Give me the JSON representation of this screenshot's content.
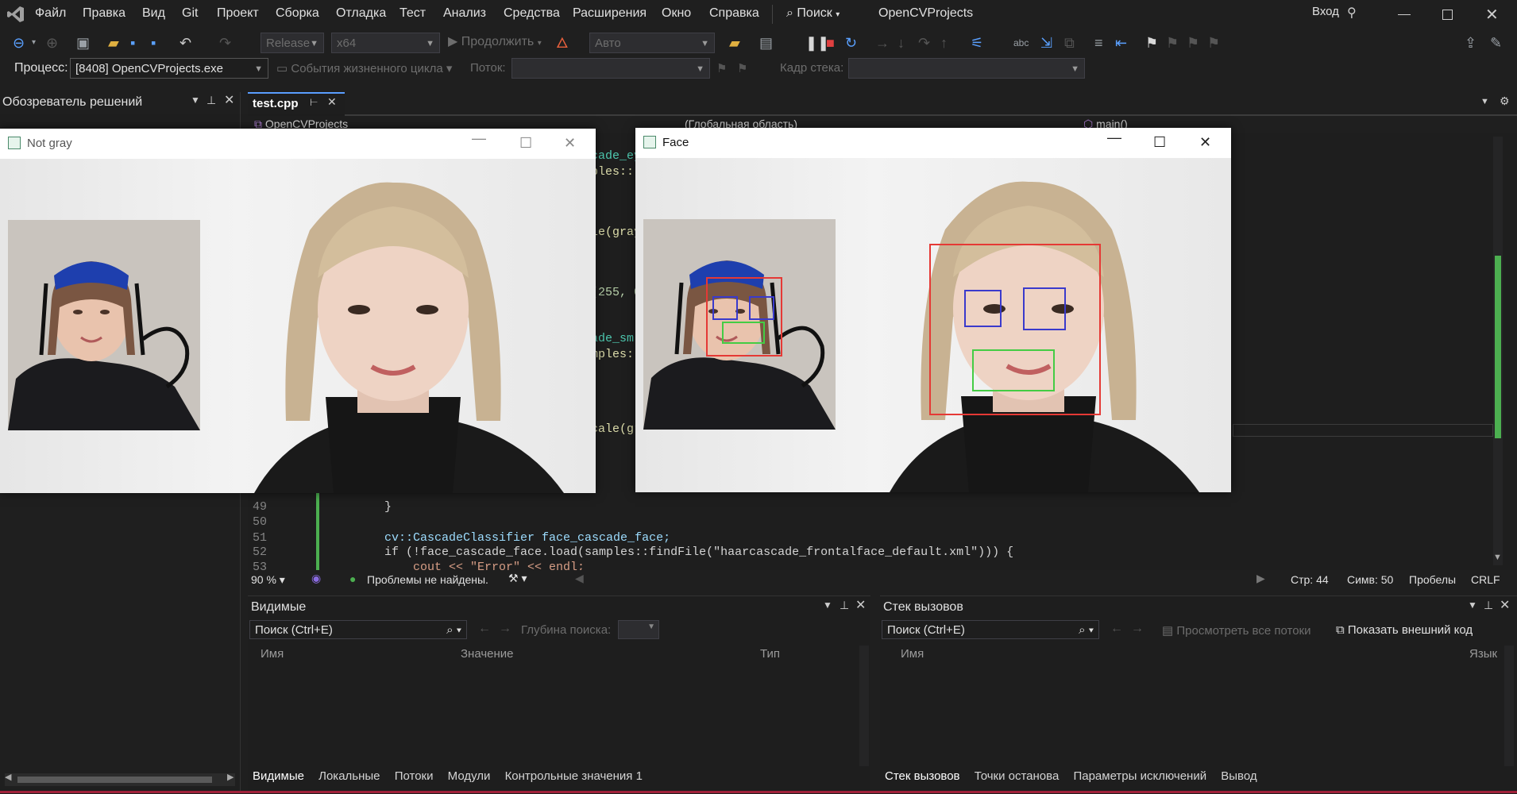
{
  "menu": {
    "items": [
      "Файл",
      "Правка",
      "Вид",
      "Git",
      "Проект",
      "Сборка",
      "Отладка",
      "Тест",
      "Анализ",
      "Средства",
      "Расширения",
      "Окно",
      "Справка"
    ],
    "search_label": "Поиск",
    "project_name": "OpenCVProjects",
    "signin_label": "Вход"
  },
  "toolbar": {
    "config": "Release",
    "platform": "x64",
    "continue_label": "Продолжить",
    "auto_label": "Авто"
  },
  "debug_bar": {
    "process_label": "Процесс:",
    "process_value": "[8408] OpenCVProjects.exe",
    "lifecycle_label": "События жизненного цикла",
    "thread_label": "Поток:",
    "stackframe_label": "Кадр стека:"
  },
  "solution_explorer": {
    "title": "Обозреватель решений"
  },
  "editor": {
    "tab_name": "test.cpp",
    "nav_project": "OpenCVProjects",
    "nav_scope": "(Глобальная область)",
    "nav_member": "main()",
    "partial_code": [
      "cade_ey",
      "ples::",
      "le(gray",
      "(255, 0",
      "ade_sm",
      "mples:",
      "cale(gr"
    ],
    "lines": [
      {
        "num": "49",
        "code": "        }"
      },
      {
        "num": "50",
        "code": ""
      },
      {
        "num": "51",
        "code": "        cv::CascadeClassifier face_cascade_face;"
      },
      {
        "num": "52",
        "code": "        if (!face_cascade_face.load(samples::findFile(\"haarcascade_frontalface_default.xml\"))) {"
      },
      {
        "num": "53",
        "code": "            cout << \"Error\" << endl;"
      }
    ]
  },
  "status": {
    "zoom": "90 %",
    "problems": "Проблемы не найдены.",
    "line": "Стр: 44",
    "char": "Симв: 50",
    "spaces": "Пробелы",
    "eol": "CRLF"
  },
  "locals_panel": {
    "title": "Видимые",
    "search_placeholder": "Поиск (Ctrl+E)",
    "depth_label": "Глубина поиска:",
    "col_name": "Имя",
    "col_value": "Значение",
    "col_type": "Тип",
    "tabs": [
      "Видимые",
      "Локальные",
      "Потоки",
      "Модули",
      "Контрольные значения 1"
    ]
  },
  "callstack_panel": {
    "title": "Стек вызовов",
    "search_placeholder": "Поиск (Ctrl+E)",
    "view_threads_label": "Просмотреть все потоки",
    "show_external_label": "Показать внешний код",
    "col_name": "Имя",
    "col_lang": "Язык",
    "tabs": [
      "Стек вызовов",
      "Точки останова",
      "Параметры исключений",
      "Вывод"
    ]
  },
  "window_notgray": {
    "title": "Not gray"
  },
  "window_face": {
    "title": "Face"
  },
  "colors": {
    "accent_green": "#4caf50",
    "face_rect": "#e53935",
    "eye_rect": "#3a3acc",
    "smile_rect": "#44cc44"
  }
}
